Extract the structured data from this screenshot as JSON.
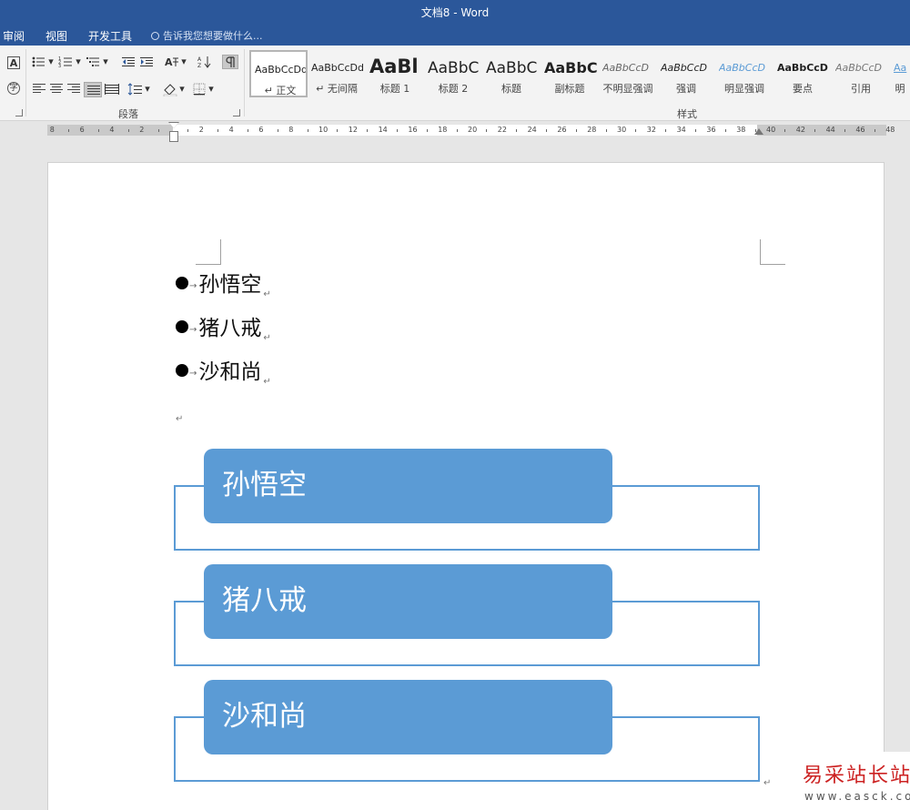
{
  "window": {
    "title": "文档8 - Word"
  },
  "tabs": [
    {
      "label": "审阅"
    },
    {
      "label": "视图"
    },
    {
      "label": "开发工具"
    }
  ],
  "tell_me": {
    "placeholder": "告诉我您想要做什么..."
  },
  "ribbon": {
    "font_group": {
      "char_border_label": "A",
      "enclosed_char_label": "字"
    },
    "paragraph_group": {
      "label": "段落"
    },
    "styles_group": {
      "label": "样式",
      "items": [
        {
          "sample": "AaBbCcDd",
          "name": "↵ 正文",
          "selected": true
        },
        {
          "sample": "AaBbCcDd",
          "name": "↵ 无间隔"
        },
        {
          "sample": "AaBl",
          "name": "标题 1"
        },
        {
          "sample": "AaBbC",
          "name": "标题 2"
        },
        {
          "sample": "AaBbC",
          "name": "标题"
        },
        {
          "sample": "AaBbC",
          "name": "副标题"
        },
        {
          "sample": "AaBbCcD",
          "name": "不明显强调"
        },
        {
          "sample": "AaBbCcD",
          "name": "强调"
        },
        {
          "sample": "AaBbCcD",
          "name": "明显强调"
        },
        {
          "sample": "AaBbCcD",
          "name": "要点"
        },
        {
          "sample": "AaBbCcD",
          "name": "引用"
        },
        {
          "sample": "Aa",
          "name": "明"
        }
      ]
    }
  },
  "ruler": {
    "labels": [
      "8",
      "6",
      "4",
      "2",
      "",
      "2",
      "4",
      "6",
      "8",
      "10",
      "12",
      "14",
      "16",
      "18",
      "20",
      "22",
      "24",
      "26",
      "28",
      "30",
      "32",
      "34",
      "36",
      "38",
      "40",
      "42",
      "44",
      "46",
      "48"
    ]
  },
  "document": {
    "bullet_list": [
      {
        "text": "孙悟空"
      },
      {
        "text": "猪八戒"
      },
      {
        "text": "沙和尚"
      }
    ],
    "tab_glyph": "→",
    "para_mark": "↵",
    "smartart": [
      {
        "text": "孙悟空"
      },
      {
        "text": "猪八戒"
      },
      {
        "text": "沙和尚"
      }
    ]
  },
  "watermark": {
    "title": "易采站长站",
    "url": "www.easck.com"
  },
  "colors": {
    "title_bar": "#2b579a",
    "smartart_fill": "#5b9bd5",
    "watermark_title": "#cc2222"
  }
}
